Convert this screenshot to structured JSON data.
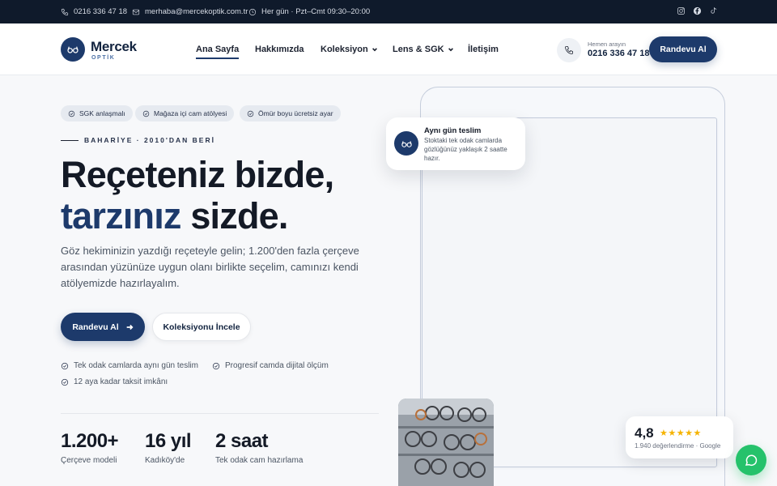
{
  "topbar": {
    "phone": "0216 336 47 18",
    "email": "merhaba@mercekoptik.com.tr",
    "hours": "Her gün · Pzt–Cmt 09:30–20:00",
    "social": [
      "instagram-icon",
      "facebook-icon",
      "tiktok-icon"
    ]
  },
  "header": {
    "brand": "Mercek",
    "brand_sub": "OPTİK",
    "nav": [
      {
        "label": "Ana Sayfa",
        "active": true
      },
      {
        "label": "Hakkımızda"
      },
      {
        "label": "Koleksiyon",
        "dropdown": true
      },
      {
        "label": "Lens & SGK",
        "dropdown": true
      },
      {
        "label": "İletişim"
      }
    ],
    "call_label": "Hemen arayın",
    "call_number": "0216 336 47 18",
    "cta": "Randevu Al"
  },
  "hero": {
    "chips": [
      "SGK anlaşmalı",
      "Mağaza içi cam atölyesi",
      "Ömür boyu ücretsiz ayar"
    ],
    "eyebrow": "BAHARİYE · 2010'DAN BERİ",
    "headline_line1": "Reçeteniz bizde,",
    "headline_accent": "tarzınız",
    "headline_rest": " sizde.",
    "lead": "Göz hekiminizin yazdığı reçeteyle gelin; 1.200'den fazla çerçeve arasından yüzünüze uygun olanı birlikte seçelim, camınızı kendi atölyemizde hazırlayalım.",
    "primary_cta": "Randevu Al",
    "secondary_cta": "Koleksiyonu İncele",
    "features": [
      "Tek odak camlarda aynı gün teslim",
      "Progresif camda dijital ölçüm",
      "12 aya kadar taksit imkânı"
    ],
    "stats": [
      {
        "value": "1.200+",
        "label": "Çerçeve modeli"
      },
      {
        "value": "16 yıl",
        "label": "Kadıköy'de"
      },
      {
        "value": "2 saat",
        "label": "Tek odak cam hazırlama"
      }
    ]
  },
  "float_card": {
    "title": "Aynı gün teslim",
    "desc": "Stoktaki tek odak camlarda gözlüğünüz yaklaşık 2 saatte hazır."
  },
  "rating": {
    "score": "4,8",
    "stars": "★★★★★",
    "reviews": "1.940 değerlendirme · Google"
  },
  "colors": {
    "brand": "#1d3a6b",
    "topbar": "#0f1a2b",
    "whatsapp": "#25c26b",
    "star": "#f5b301"
  }
}
